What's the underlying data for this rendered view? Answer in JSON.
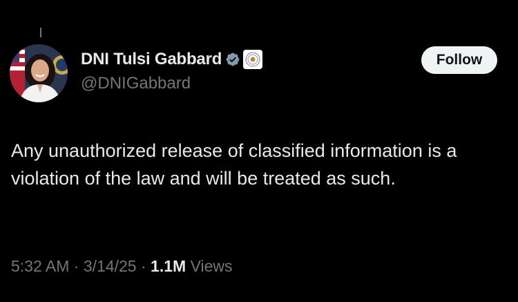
{
  "tweet": {
    "author": {
      "display_name": "DNI Tulsi Gabbard",
      "handle": "@DNIGabbard",
      "avatar": "avatar-photo",
      "verified_icon": "verified-check-icon",
      "affiliate_icon": "dni-seal-icon"
    },
    "follow_label": "Follow",
    "text": "Any unauthorized release of classified information is a violation of the law and will be treated as such.",
    "time": "5:32 AM",
    "date": "3/14/25",
    "separator": " · ",
    "views_count": "1.1M",
    "views_label": " Views"
  },
  "colors": {
    "background": "#000000",
    "primary_text": "#e7e9ea",
    "secondary_text": "#71767b",
    "verified_blue": "#1d9bf0",
    "follow_bg": "#eff3f4"
  }
}
